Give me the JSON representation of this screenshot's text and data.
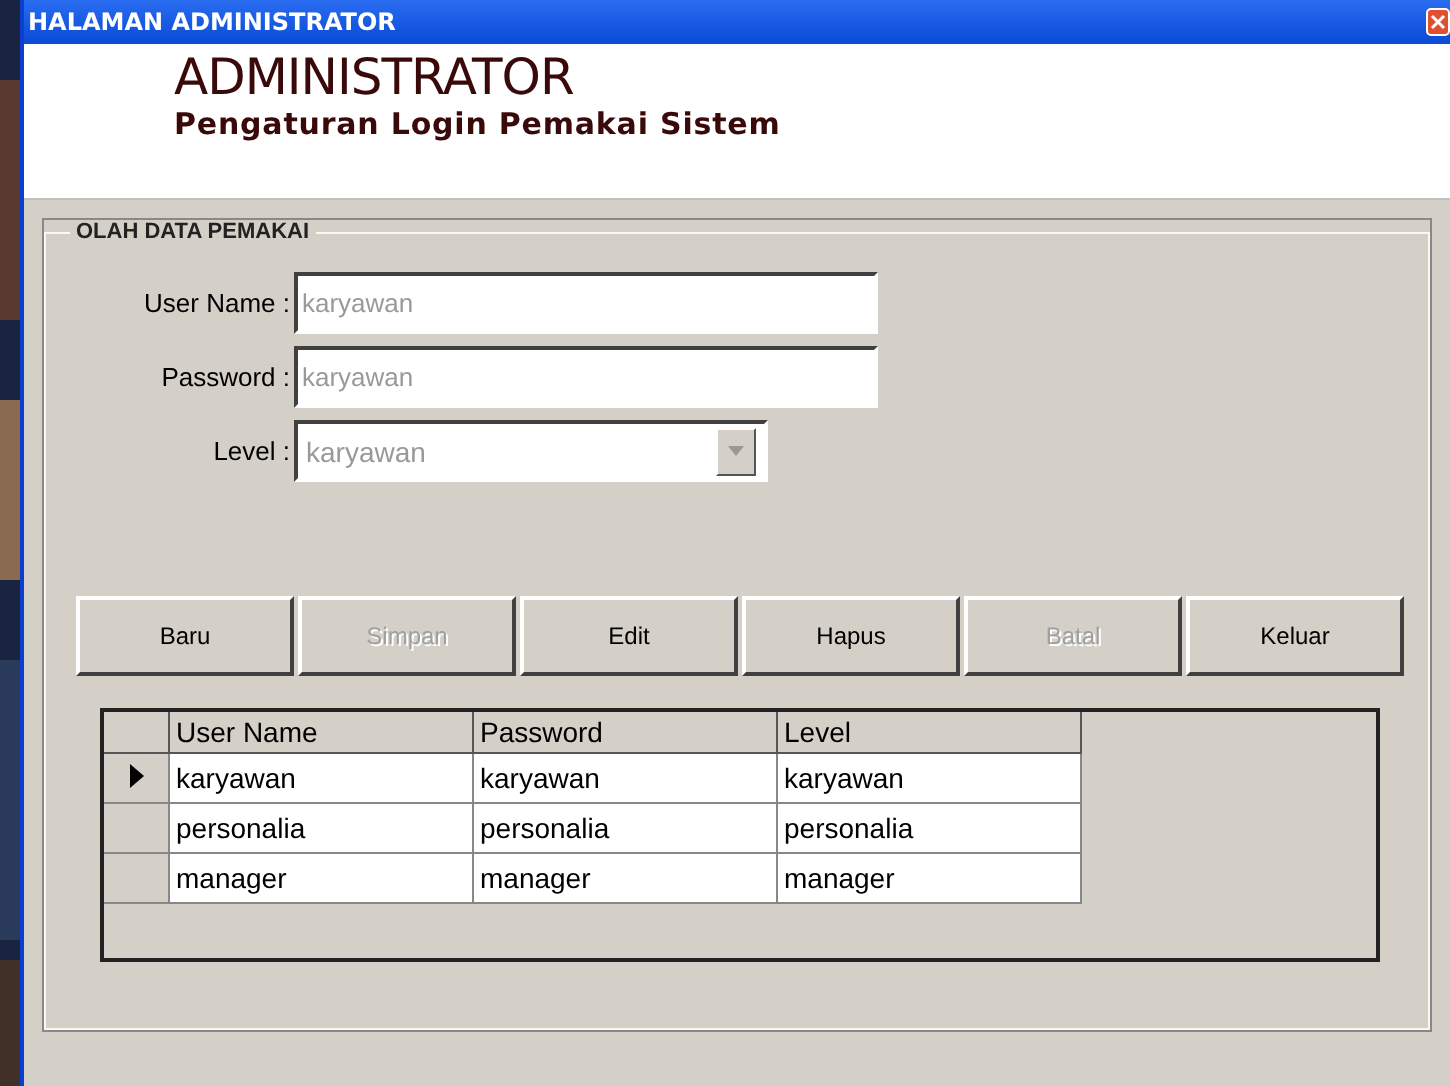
{
  "window": {
    "title": "HALAMAN ADMINISTRATOR"
  },
  "header": {
    "title": "ADMINISTRATOR",
    "subtitle": "Pengaturan Login Pemakai Sistem"
  },
  "group": {
    "title": "OLAH DATA PEMAKAI"
  },
  "fields": [
    {
      "kind": "text",
      "label": "User Name :",
      "value": "karyawan",
      "disabled": true
    },
    {
      "kind": "text",
      "label": "Password :",
      "value": "karyawan",
      "disabled": true
    },
    {
      "kind": "combo",
      "label": "Level :",
      "value": "karyawan",
      "disabled": true
    }
  ],
  "buttons": [
    {
      "label": "Baru",
      "disabled": false
    },
    {
      "label": "Simpan",
      "disabled": true
    },
    {
      "label": "Edit",
      "disabled": false
    },
    {
      "label": "Hapus",
      "disabled": false
    },
    {
      "label": "Batal",
      "disabled": true
    },
    {
      "label": "Keluar",
      "disabled": false
    }
  ],
  "table": {
    "columns": [
      "User Name",
      "Password",
      "Level"
    ],
    "rows": [
      {
        "cells": [
          "karyawan",
          "karyawan",
          "karyawan"
        ],
        "selected": true
      },
      {
        "cells": [
          "personalia",
          "personalia",
          "personalia"
        ],
        "selected": false
      },
      {
        "cells": [
          "manager",
          "manager",
          "manager"
        ],
        "selected": false
      }
    ]
  }
}
